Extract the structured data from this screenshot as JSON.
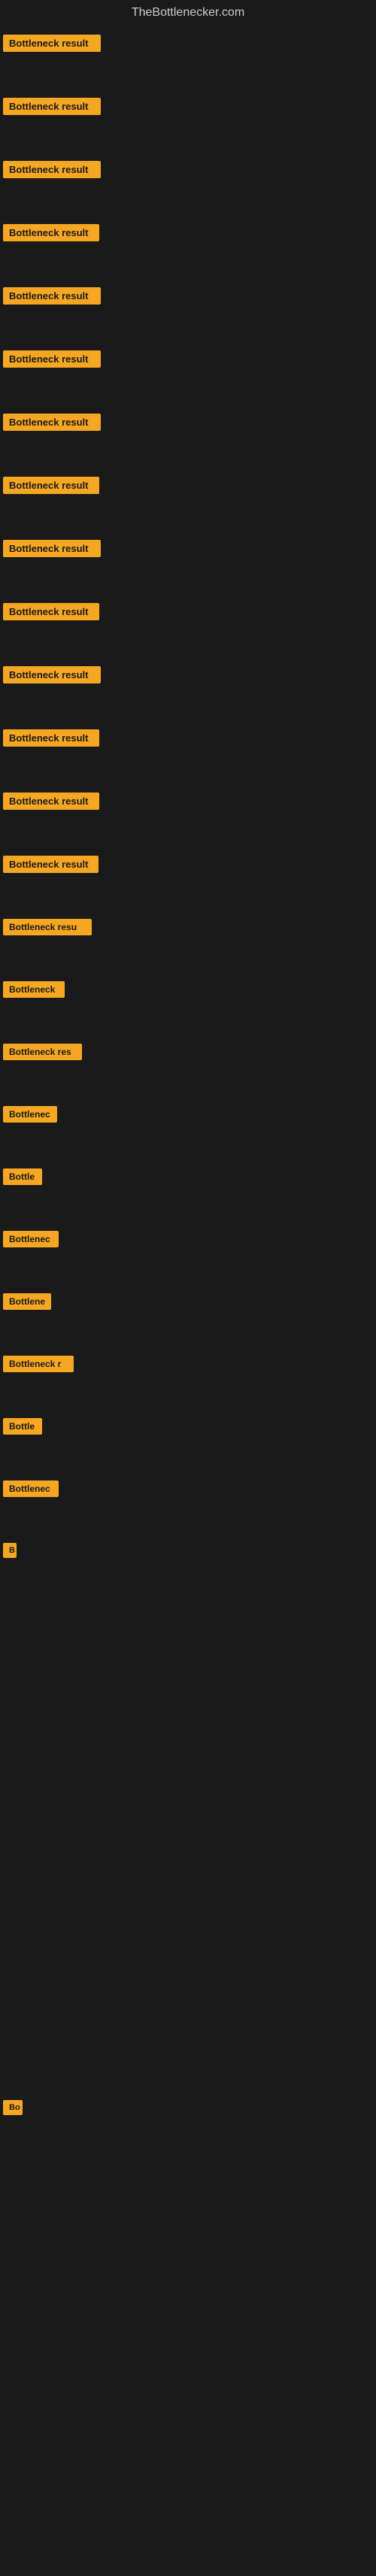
{
  "site": {
    "title": "TheBottlenecker.com"
  },
  "rows": [
    {
      "id": 1,
      "label": "Bottleneck result",
      "width": 130,
      "top_gap": 0
    },
    {
      "id": 2,
      "label": "Bottleneck result",
      "width": 130,
      "top_gap": 50
    },
    {
      "id": 3,
      "label": "Bottleneck result",
      "width": 130,
      "top_gap": 50
    },
    {
      "id": 4,
      "label": "Bottleneck result",
      "width": 128,
      "top_gap": 50
    },
    {
      "id": 5,
      "label": "Bottleneck result",
      "width": 130,
      "top_gap": 50
    },
    {
      "id": 6,
      "label": "Bottleneck result",
      "width": 130,
      "top_gap": 50
    },
    {
      "id": 7,
      "label": "Bottleneck result",
      "width": 130,
      "top_gap": 50
    },
    {
      "id": 8,
      "label": "Bottleneck result",
      "width": 128,
      "top_gap": 50
    },
    {
      "id": 9,
      "label": "Bottleneck result",
      "width": 130,
      "top_gap": 50
    },
    {
      "id": 10,
      "label": "Bottleneck result",
      "width": 128,
      "top_gap": 50
    },
    {
      "id": 11,
      "label": "Bottleneck result",
      "width": 130,
      "top_gap": 50
    },
    {
      "id": 12,
      "label": "Bottleneck result",
      "width": 128,
      "top_gap": 50
    },
    {
      "id": 13,
      "label": "Bottleneck result",
      "width": 128,
      "top_gap": 50
    },
    {
      "id": 14,
      "label": "Bottleneck result",
      "width": 127,
      "top_gap": 50
    },
    {
      "id": 15,
      "label": "Bottleneck resu",
      "width": 115,
      "top_gap": 50
    },
    {
      "id": 16,
      "label": "Bottleneck",
      "width": 80,
      "top_gap": 50
    },
    {
      "id": 17,
      "label": "Bottleneck res",
      "width": 105,
      "top_gap": 50
    },
    {
      "id": 18,
      "label": "Bottlenec",
      "width": 70,
      "top_gap": 50
    },
    {
      "id": 19,
      "label": "Bottle",
      "width": 55,
      "top_gap": 50
    },
    {
      "id": 20,
      "label": "Bottlenec",
      "width": 72,
      "top_gap": 50
    },
    {
      "id": 21,
      "label": "Bottlene",
      "width": 62,
      "top_gap": 50
    },
    {
      "id": 22,
      "label": "Bottleneck r",
      "width": 92,
      "top_gap": 50
    },
    {
      "id": 23,
      "label": "Bottle",
      "width": 54,
      "top_gap": 50
    },
    {
      "id": 24,
      "label": "Bottlenec",
      "width": 72,
      "top_gap": 50
    },
    {
      "id": 25,
      "label": "B",
      "width": 18,
      "top_gap": 50
    },
    {
      "id": 26,
      "label": "Bo",
      "width": 26,
      "top_gap": 700
    }
  ],
  "colors": {
    "background": "#1a1a1a",
    "label_bg": "#f5a623",
    "label_text": "#1a1a1a",
    "title_text": "#cccccc"
  }
}
